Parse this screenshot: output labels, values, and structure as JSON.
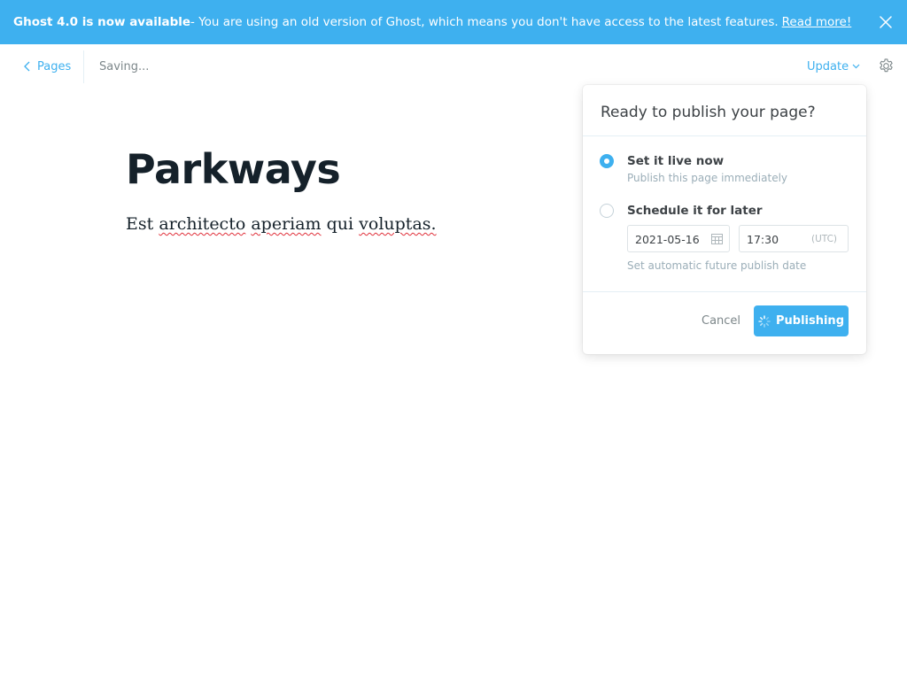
{
  "banner": {
    "headline": "Ghost 4.0 is now available",
    "message": " - You are using an old version of Ghost, which means you don't have access to the latest features.",
    "link": "Read more!"
  },
  "header": {
    "back_label": "Pages",
    "status": "Saving...",
    "update_label": "Update"
  },
  "post": {
    "title": "Parkways",
    "body_words": [
      "Est",
      "architecto",
      "aperiam",
      "qui",
      "voluptas."
    ]
  },
  "publish_menu": {
    "title": "Ready to publish your page?",
    "options": [
      {
        "label": "Set it live now",
        "description": "Publish this page immediately",
        "selected": true
      },
      {
        "label": "Schedule it for later",
        "description": "Set automatic future publish date",
        "selected": false
      }
    ],
    "date": "2021-05-16",
    "time": "17:30",
    "timezone": "(UTC)",
    "cancel_label": "Cancel",
    "publish_label": "Publishing"
  },
  "colors": {
    "accent": "#3eb0ef",
    "text": "#15212a",
    "muted": "#7d878a"
  },
  "icons": {
    "close": "close-icon",
    "back": "chevron-left-icon",
    "dropdown": "chevron-down-icon",
    "settings": "gear-icon",
    "calendar": "calendar-icon",
    "spinner": "spinner-icon"
  }
}
